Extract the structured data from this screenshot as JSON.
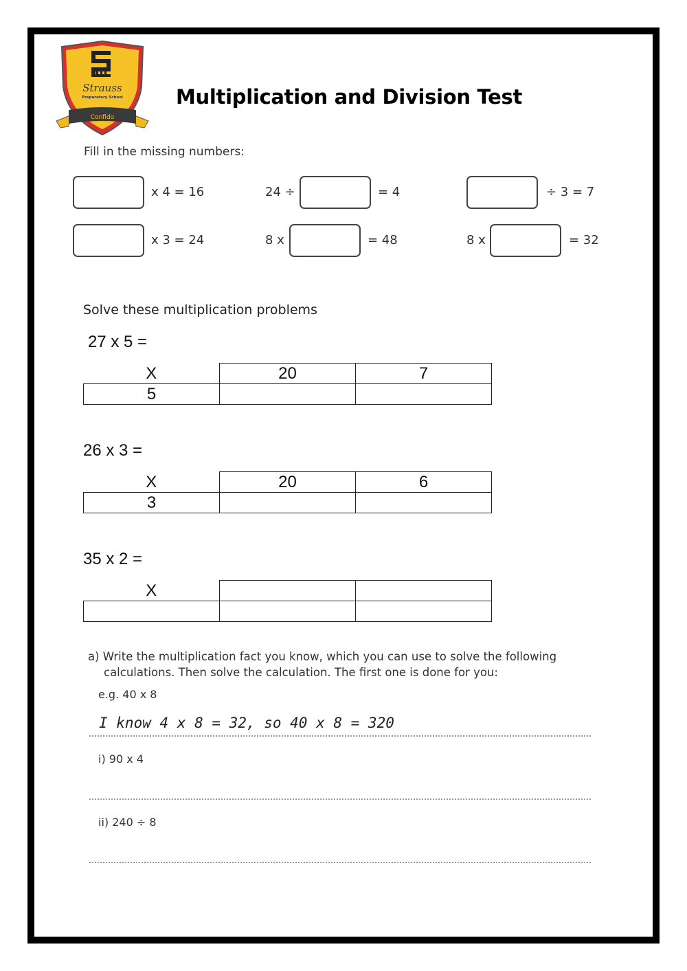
{
  "header": {
    "logo": {
      "name": "Strauss",
      "subtitle": "Preparatory School",
      "motto": "Confido",
      "colors": {
        "shield": "#F5C228",
        "border": "#D8312C",
        "banner": "#3A3A3A",
        "ribbon": "#F2B81C"
      }
    },
    "title": "Multiplication and Division Test"
  },
  "missing_numbers": {
    "instruction": "Fill in the missing numbers:",
    "rows": [
      [
        {
          "before": "",
          "after": "x 4 = 16"
        },
        {
          "before": "24 ÷",
          "after": "= 4"
        },
        {
          "before": "",
          "after": "÷ 3 = 7"
        }
      ],
      [
        {
          "before": "",
          "after": "x 3 = 24"
        },
        {
          "before": "8 x",
          "after": "= 48"
        },
        {
          "before": "8 x",
          "after": "= 32"
        }
      ]
    ]
  },
  "grid_section": {
    "heading": "Solve these multiplication problems",
    "problems": [
      {
        "question": "27 x 5  =",
        "header": [
          "X",
          "20",
          "7"
        ],
        "row": [
          "5",
          "",
          ""
        ]
      },
      {
        "question": "26 x 3 =",
        "header": [
          "X",
          "20",
          "6"
        ],
        "row": [
          "3",
          "",
          ""
        ]
      },
      {
        "question": "35 x 2 =",
        "header": [
          "X",
          "",
          ""
        ],
        "row": [
          "",
          "",
          ""
        ]
      }
    ]
  },
  "facts_section": {
    "instruction_line1": "a) Write the multiplication fact you know, which you can use to solve the following",
    "instruction_line2": "calculations. Then solve the calculation. The first one is done for you:",
    "example_label": "e.g. 40 x 8",
    "example_answer": "I know 4 x 8 = 32, so 40 x 8 = 320",
    "items": [
      {
        "label": "i) 90 x 4",
        "answer": ""
      },
      {
        "label": "ii) 240 ÷ 8",
        "answer": ""
      }
    ]
  }
}
